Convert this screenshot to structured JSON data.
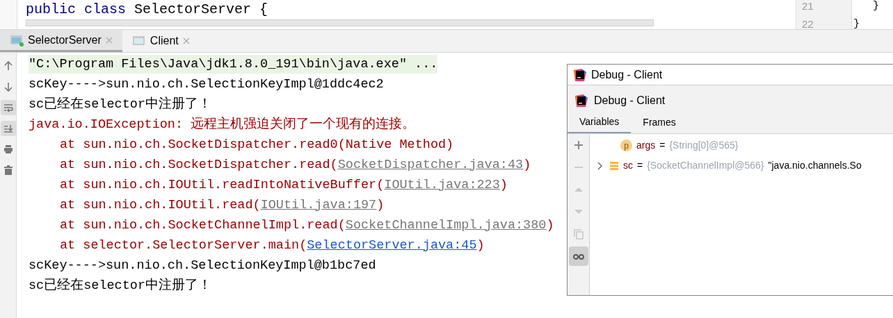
{
  "editor": {
    "code": [
      {
        "text": "public class ",
        "kind": "keyword"
      },
      {
        "text": "SelectorServer {",
        "kind": "plain"
      }
    ],
    "right_lines": [
      {
        "number": "21",
        "code": "}"
      },
      {
        "number": "22",
        "code": "}"
      }
    ]
  },
  "run_tabs": [
    {
      "label": "SelectorServer",
      "selected": true,
      "running": true
    },
    {
      "label": "Client",
      "selected": false,
      "running": false
    }
  ],
  "console": {
    "tools": [
      {
        "kind": "up",
        "selected": false
      },
      {
        "kind": "down",
        "selected": false
      },
      {
        "kind": "wrap",
        "selected": true
      },
      {
        "kind": "scroll-end",
        "selected": true
      },
      {
        "kind": "print",
        "selected": false
      },
      {
        "kind": "trash",
        "selected": false
      }
    ],
    "lines": [
      {
        "kind": "command",
        "segments": [
          {
            "text": "\"C:\\Program Files\\Java\\jdk1.8.0_191\\bin\\java.exe\" ...",
            "kind": "plain"
          }
        ]
      },
      {
        "kind": "out",
        "segments": [
          {
            "text": "scKey---->sun.nio.ch.SelectionKeyImpl@1ddc4ec2",
            "kind": "plain"
          }
        ]
      },
      {
        "kind": "out",
        "segments": [
          {
            "text": "sc已经在selector中注册了！",
            "kind": "plain"
          }
        ]
      },
      {
        "kind": "err",
        "segments": [
          {
            "text": "java.io.IOException: 远程主机强迫关闭了一个现有的连接。",
            "kind": "plain"
          }
        ]
      },
      {
        "kind": "trace",
        "segments": [
          {
            "text": "at sun.nio.ch.SocketDispatcher.read0(Native Method)",
            "kind": "plain"
          }
        ]
      },
      {
        "kind": "trace",
        "segments": [
          {
            "text": "at sun.nio.ch.SocketDispatcher.read(",
            "kind": "plain"
          },
          {
            "text": "SocketDispatcher.java:43",
            "kind": "link"
          },
          {
            "text": ")",
            "kind": "plain"
          }
        ]
      },
      {
        "kind": "trace",
        "segments": [
          {
            "text": "at sun.nio.ch.IOUtil.readIntoNativeBuffer(",
            "kind": "plain"
          },
          {
            "text": "IOUtil.java:223",
            "kind": "link"
          },
          {
            "text": ")",
            "kind": "plain"
          }
        ]
      },
      {
        "kind": "trace",
        "segments": [
          {
            "text": "at sun.nio.ch.IOUtil.read(",
            "kind": "plain"
          },
          {
            "text": "IOUtil.java:197",
            "kind": "link"
          },
          {
            "text": ")",
            "kind": "plain"
          }
        ]
      },
      {
        "kind": "trace",
        "segments": [
          {
            "text": "at sun.nio.ch.SocketChannelImpl.read(",
            "kind": "plain"
          },
          {
            "text": "SocketChannelImpl.java:380",
            "kind": "link"
          },
          {
            "text": ")",
            "kind": "plain"
          }
        ]
      },
      {
        "kind": "trace",
        "segments": [
          {
            "text": "at selector.SelectorServer.main(",
            "kind": "plain"
          },
          {
            "text": "SelectorServer.java:45",
            "kind": "project-link"
          },
          {
            "text": ")",
            "kind": "plain"
          }
        ]
      },
      {
        "kind": "out",
        "segments": [
          {
            "text": "scKey---->sun.nio.ch.SelectionKeyImpl@b1bc7ed",
            "kind": "plain"
          }
        ]
      },
      {
        "kind": "out",
        "segments": [
          {
            "text": "sc已经在selector中注册了！",
            "kind": "plain"
          }
        ]
      }
    ]
  },
  "debug_window": {
    "title": "Debug - Client",
    "panel_title": "Debug - Client",
    "tabs": [
      {
        "label": "Variables",
        "selected": true
      },
      {
        "label": "Frames",
        "selected": false
      }
    ],
    "tools": [
      {
        "kind": "plus",
        "selected": false
      },
      {
        "kind": "minus",
        "selected": false
      },
      {
        "kind": "up",
        "selected": false
      },
      {
        "kind": "down",
        "selected": false
      },
      {
        "kind": "copy",
        "selected": false
      },
      {
        "kind": "watch",
        "selected": true
      }
    ],
    "variables": [
      {
        "kind": "param",
        "badge": "p",
        "name": "args",
        "operator": "=",
        "value": "{String[0]@565}",
        "expandable": false
      },
      {
        "kind": "field",
        "name": "sc",
        "operator": "=",
        "value": "{SocketChannelImpl@566}",
        "detail": "\"java.nio.channels.So",
        "expandable": true
      }
    ]
  }
}
